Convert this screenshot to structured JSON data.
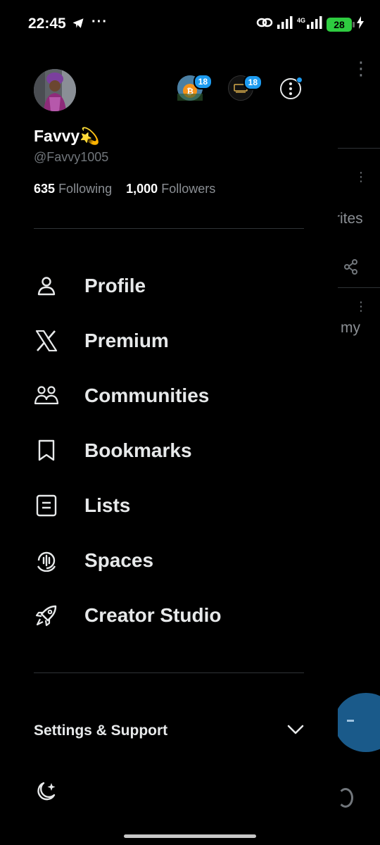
{
  "status_bar": {
    "time": "22:45",
    "dots": "···",
    "network": "4G",
    "battery": "28"
  },
  "profile": {
    "display_name": "Favvy💫",
    "handle": "@Favvy1005",
    "following_count": "635",
    "following_label": "Following",
    "followers_count": "1,000",
    "followers_label": "Followers"
  },
  "accounts": [
    {
      "badge": "18"
    },
    {
      "badge": "18"
    }
  ],
  "menu": [
    {
      "label": "Profile",
      "icon": "person-icon"
    },
    {
      "label": "Premium",
      "icon": "x-logo-icon"
    },
    {
      "label": "Communities",
      "icon": "communities-icon"
    },
    {
      "label": "Bookmarks",
      "icon": "bookmark-icon"
    },
    {
      "label": "Lists",
      "icon": "list-icon"
    },
    {
      "label": "Spaces",
      "icon": "spaces-icon"
    },
    {
      "label": "Creator Studio",
      "icon": "rocket-icon"
    }
  ],
  "settings": {
    "label": "Settings & Support"
  },
  "background": {
    "text_1": "rites",
    "text_2": "my"
  },
  "colors": {
    "background": "#000000",
    "text": "#e7e9ea",
    "muted": "#71767b",
    "accent": "#1d9bf0",
    "battery": "#2ecc40"
  }
}
